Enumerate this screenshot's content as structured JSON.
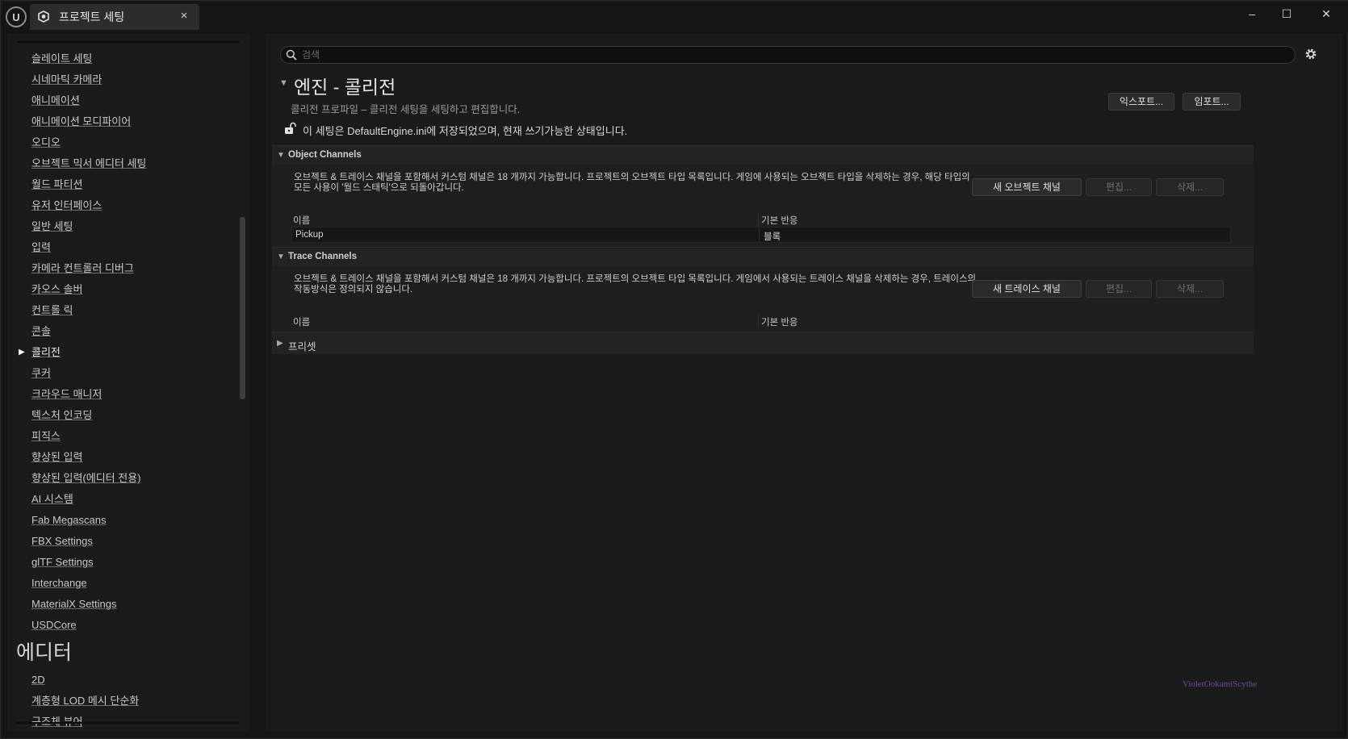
{
  "titlebar": {
    "app_logo": "U",
    "tab_label": "프로젝트 세팅",
    "tab_close": "×",
    "minimize": "–",
    "maximize": "☐",
    "close": "✕"
  },
  "sidebar": {
    "items": [
      "슬레이트 세팅",
      "시네마틱 카메라",
      "애니메이션",
      "애니메이션 모디파이어",
      "오디오",
      "오브젝트 믹서 에디터 세팅",
      "월드 파티션",
      "유저 인터페이스",
      "일반 세팅",
      "입력",
      "카메라 컨트롤러 디버그",
      "카오스 솔버",
      "컨트롤 릭",
      "콘솔",
      "콜리전",
      "쿠커",
      "크라우드 매니저",
      "텍스처 인코딩",
      "피직스",
      "향상된 입력",
      "향상된 입력(에디터 전용)",
      "AI 시스템",
      "Fab Megascans",
      "FBX Settings",
      "glTF Settings",
      "Interchange",
      "MaterialX Settings",
      "USDCore"
    ],
    "active_index": 14,
    "heading": "에디터",
    "editor_items": [
      "2D",
      "계층형 LOD 메시 단순화",
      "구조체 뷰어"
    ]
  },
  "main": {
    "search_placeholder": "검색",
    "title": "엔진 - 콜리전",
    "description": "콜리전 프로파일 – 콜리전 세팅을 세팅하고 편집합니다.",
    "export_label": "익스포트...",
    "import_label": "임포트...",
    "save_note": "이 세팅은 DefaultEngine.ini에 저장되었으며, 현재 쓰기가능한 상태입니다.",
    "object_channels": {
      "title": "Object Channels",
      "description": "오브젝트 & 트레이스 채널을 포함해서 커스텀 채널은 18 개까지 가능합니다. 프로젝트의 오브젝트 타입 목록입니다. 게임에 사용되는 오브젝트 타입을 삭제하는 경우, 해당 타입의 모든 사용이 '월드 스태틱'으로 되돌아갑니다.",
      "new_button": "새 오브젝트 채널",
      "edit_button": "편집...",
      "delete_button": "삭제...",
      "col_name": "이름",
      "col_response": "기본 반응",
      "rows": [
        {
          "name": "Pickup",
          "response": "블록"
        }
      ]
    },
    "trace_channels": {
      "title": "Trace Channels",
      "description": "오브젝트 & 트레이스 채널을 포함해서 커스텀 채널은 18 개까지 가능합니다. 프로젝트의 오브젝트 타입 목록입니다. 게임에서 사용되는 트레이스 채널을 삭제하는 경우, 트레이스의 작동방식은 정의되지 않습니다.",
      "new_button": "새 트레이스 채널",
      "edit_button": "편집...",
      "delete_button": "삭제...",
      "col_name": "이름",
      "col_response": "기본 반응"
    },
    "presets": {
      "title": "프리셋"
    }
  },
  "watermark": "VioletOokamiScythe"
}
